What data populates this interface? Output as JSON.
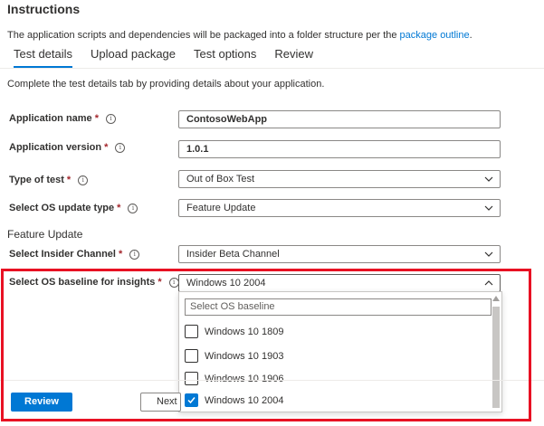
{
  "header": {
    "title": "Instructions",
    "description_prefix": "The application scripts and dependencies will be packaged into a folder structure per the ",
    "description_link": "package outline",
    "description_suffix": "."
  },
  "tabs": [
    {
      "label": "Test details",
      "active": true
    },
    {
      "label": "Upload package",
      "active": false
    },
    {
      "label": "Test options",
      "active": false
    },
    {
      "label": "Review",
      "active": false
    }
  ],
  "hint": "Complete the test details tab by providing details about your application.",
  "form": {
    "app_name": {
      "label": "Application name",
      "required": "*",
      "value": "ContosoWebApp"
    },
    "app_version": {
      "label": "Application version",
      "required": "*",
      "value": "1.0.1"
    },
    "test_type": {
      "label": "Type of test",
      "required": "*",
      "value": "Out of Box Test"
    },
    "os_update_type": {
      "label": "Select OS update type",
      "required": "*",
      "value": "Feature Update"
    },
    "section_heading": "Feature Update",
    "insider_channel": {
      "label": "Select Insider Channel",
      "required": "*",
      "value": "Insider Beta Channel"
    },
    "os_baseline": {
      "label": "Select OS baseline for insights",
      "required": "*",
      "value": "Windows 10 2004"
    }
  },
  "dropdown": {
    "search_placeholder": "Select OS baseline",
    "options": [
      {
        "label": "Windows 10 1809",
        "checked": false
      },
      {
        "label": "Windows 10 1903",
        "checked": false
      },
      {
        "label": "Windows 10 1906",
        "checked": false
      },
      {
        "label": "Windows 10 2004",
        "checked": true
      }
    ]
  },
  "footer": {
    "review_label": "Review",
    "next_label": "Next"
  },
  "colors": {
    "accent": "#0078d4",
    "highlight_box": "#e81123",
    "required": "#a4262c"
  },
  "icons": {
    "info": "info-icon",
    "chevron_down": "chevron-down-icon",
    "chevron_up": "chevron-up-icon",
    "checkmark": "checkmark-icon"
  }
}
